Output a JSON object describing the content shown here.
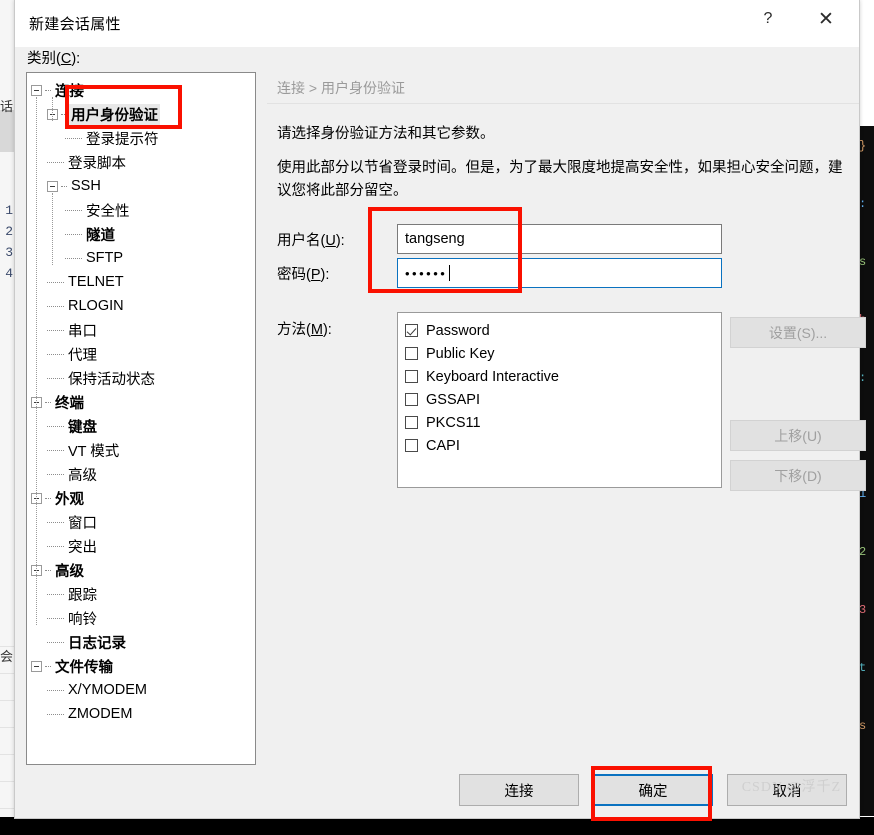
{
  "window": {
    "title": "新建会话属性",
    "help_icon": "?",
    "close_icon": "✕"
  },
  "category_label": {
    "text": "类别",
    "accel": "C",
    "suffix": ":"
  },
  "tree": {
    "items": [
      {
        "label": "连接",
        "depth": 0,
        "expander": true,
        "bold": true,
        "selected": false
      },
      {
        "label": "用户身份验证",
        "depth": 1,
        "expander": true,
        "bold": true,
        "selected": true
      },
      {
        "label": "登录提示符",
        "depth": 2,
        "expander": false,
        "bold": false,
        "selected": false
      },
      {
        "label": "登录脚本",
        "depth": 1,
        "expander": false,
        "bold": false,
        "selected": false
      },
      {
        "label": "SSH",
        "depth": 1,
        "expander": true,
        "bold": false,
        "selected": false
      },
      {
        "label": "安全性",
        "depth": 2,
        "expander": false,
        "bold": false,
        "selected": false
      },
      {
        "label": "隧道",
        "depth": 2,
        "expander": false,
        "bold": true,
        "selected": false
      },
      {
        "label": "SFTP",
        "depth": 2,
        "expander": false,
        "bold": false,
        "selected": false
      },
      {
        "label": "TELNET",
        "depth": 1,
        "expander": false,
        "bold": false,
        "selected": false
      },
      {
        "label": "RLOGIN",
        "depth": 1,
        "expander": false,
        "bold": false,
        "selected": false
      },
      {
        "label": "串口",
        "depth": 1,
        "expander": false,
        "bold": false,
        "selected": false
      },
      {
        "label": "代理",
        "depth": 1,
        "expander": false,
        "bold": false,
        "selected": false
      },
      {
        "label": "保持活动状态",
        "depth": 1,
        "expander": false,
        "bold": false,
        "selected": false
      },
      {
        "label": "终端",
        "depth": 0,
        "expander": true,
        "bold": true,
        "selected": false
      },
      {
        "label": "键盘",
        "depth": 1,
        "expander": false,
        "bold": true,
        "selected": false
      },
      {
        "label": "VT 模式",
        "depth": 1,
        "expander": false,
        "bold": false,
        "selected": false
      },
      {
        "label": "高级",
        "depth": 1,
        "expander": false,
        "bold": false,
        "selected": false
      },
      {
        "label": "外观",
        "depth": 0,
        "expander": true,
        "bold": true,
        "selected": false
      },
      {
        "label": "窗口",
        "depth": 1,
        "expander": false,
        "bold": false,
        "selected": false
      },
      {
        "label": "突出",
        "depth": 1,
        "expander": false,
        "bold": false,
        "selected": false
      },
      {
        "label": "高级",
        "depth": 0,
        "expander": true,
        "bold": true,
        "selected": false
      },
      {
        "label": "跟踪",
        "depth": 1,
        "expander": false,
        "bold": false,
        "selected": false
      },
      {
        "label": "响铃",
        "depth": 1,
        "expander": false,
        "bold": false,
        "selected": false
      },
      {
        "label": "日志记录",
        "depth": 1,
        "expander": false,
        "bold": true,
        "selected": false
      },
      {
        "label": "文件传输",
        "depth": 0,
        "expander": true,
        "bold": true,
        "selected": false
      },
      {
        "label": "X/YMODEM",
        "depth": 1,
        "expander": false,
        "bold": false,
        "selected": false
      },
      {
        "label": "ZMODEM",
        "depth": 1,
        "expander": false,
        "bold": false,
        "selected": false
      }
    ]
  },
  "content": {
    "breadcrumb": "连接 > 用户身份验证",
    "description_1": "请选择身份验证方法和其它参数。",
    "description_2": "使用此部分以节省登录时间。但是，为了最大限度地提高安全性，如果担心安全问题，建议您将此部分留空。",
    "username": {
      "label_text": "用户名",
      "label_accel": "U",
      "label_suffix": ":",
      "value": "tangseng",
      "placeholder": ""
    },
    "password": {
      "label_text": "密码",
      "label_accel": "P",
      "label_suffix": ":",
      "value": "••••••",
      "placeholder": "",
      "focused": true
    },
    "methods": {
      "label_text": "方法",
      "label_accel": "M",
      "label_suffix": ":",
      "items": [
        {
          "label": "Password",
          "checked": true
        },
        {
          "label": "Public Key",
          "checked": false
        },
        {
          "label": "Keyboard Interactive",
          "checked": false
        },
        {
          "label": "GSSAPI",
          "checked": false
        },
        {
          "label": "PKCS11",
          "checked": false
        },
        {
          "label": "CAPI",
          "checked": false
        }
      ]
    },
    "side_buttons": [
      {
        "label": "设置(S)...",
        "enabled": false
      },
      {
        "label": "上移(U)",
        "enabled": false
      },
      {
        "label": "下移(D)",
        "enabled": false
      }
    ]
  },
  "bottom_buttons": [
    {
      "label": "连接",
      "default": false
    },
    {
      "label": "确定",
      "default": true
    },
    {
      "label": "取消",
      "default": false
    }
  ],
  "watermark": "CSDN @浮千Z",
  "background": {
    "gutter_numbers": [
      "1",
      "2",
      "3",
      "4"
    ],
    "left_fragment_top": "话",
    "left_fragment_bottom": "会",
    "right_code_fragments": [
      "}",
      ":",
      "s",
      "b",
      ":",
      "(",
      "1",
      "2",
      "3",
      "t",
      "s"
    ]
  },
  "colors": {
    "annotation_red": "#fa1000",
    "focus_blue": "#0a72c0",
    "dialog_bg": "#f0f0f0",
    "panel_white": "#ffffff"
  }
}
